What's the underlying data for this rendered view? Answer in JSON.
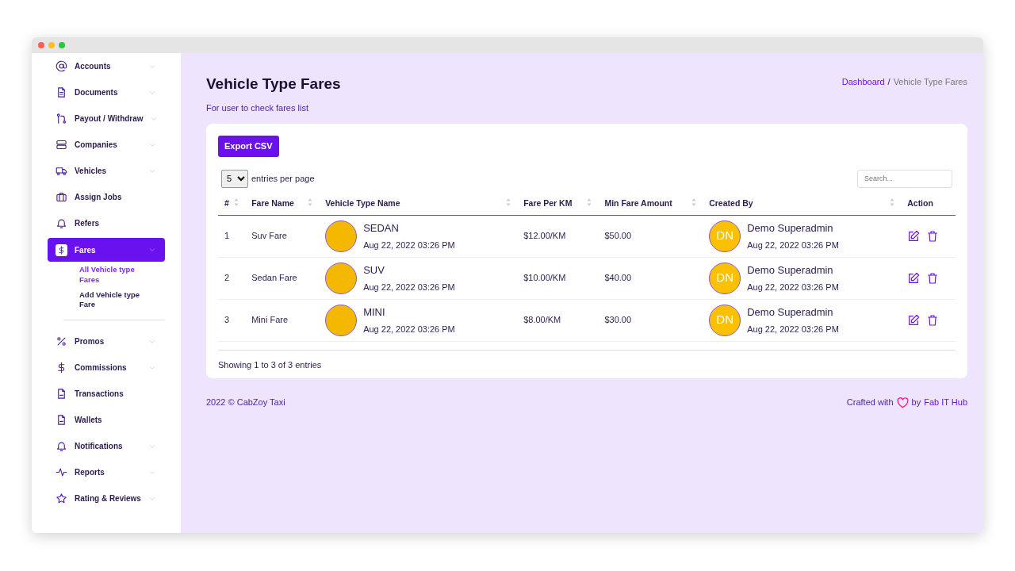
{
  "sidebar": {
    "items": [
      {
        "label": "Accounts",
        "has_submenu": true,
        "selected": false
      },
      {
        "label": "Documents",
        "has_submenu": true,
        "selected": false
      },
      {
        "label": "Payout / Withdraw",
        "has_submenu": true,
        "selected": false
      },
      {
        "label": "Companies",
        "has_submenu": true,
        "selected": false
      },
      {
        "label": "Vehicles",
        "has_submenu": true,
        "selected": false
      },
      {
        "label": "Assign Jobs",
        "has_submenu": false,
        "selected": false
      },
      {
        "label": "Refers",
        "has_submenu": false,
        "selected": false
      },
      {
        "label": "Fares",
        "has_submenu": true,
        "selected": true,
        "children": [
          {
            "label": "All Vehicle type Fares",
            "selected": true
          },
          {
            "label": "Add Vehicle type Fare",
            "selected": false
          }
        ]
      },
      {
        "label": "Promos",
        "has_submenu": true,
        "selected": false
      },
      {
        "label": "Commissions",
        "has_submenu": true,
        "selected": false
      },
      {
        "label": "Transactions",
        "has_submenu": false,
        "selected": false
      },
      {
        "label": "Wallets",
        "has_submenu": false,
        "selected": false
      },
      {
        "label": "Notifications",
        "has_submenu": true,
        "selected": false
      },
      {
        "label": "Reports",
        "has_submenu": true,
        "selected": false
      },
      {
        "label": "Rating & Reviews",
        "has_submenu": true,
        "selected": false
      }
    ]
  },
  "page": {
    "title": "Vehicle Type Fares",
    "subtitle": "For user to check fares list",
    "breadcrumb": [
      "Dashboard",
      "Vehicle Type Fares"
    ],
    "breadcrumb_separator": "/"
  },
  "toolbar": {
    "export_button": "Export CSV",
    "page_size": "5",
    "page_size_label": "entries per page",
    "search": {
      "placeholder": "Search..."
    }
  },
  "table": {
    "columns": [
      {
        "label": "#",
        "sortable": true
      },
      {
        "label": "Fare Name",
        "sortable": true
      },
      {
        "label": "Vehicle Type Name",
        "sortable": true
      },
      {
        "label": "Fare Per KM",
        "sortable": true
      },
      {
        "label": "Min Fare Amount",
        "sortable": true
      },
      {
        "label": "Created By",
        "sortable": true
      },
      {
        "label": "Action",
        "sortable": false
      }
    ],
    "rows": [
      {
        "number": "1",
        "fare_name": "Suv Fare",
        "vehicle_type": "SEDAN",
        "vehicle_date": "Aug 22, 2022 03:26 PM",
        "fare_per_km": "$12.00/KM",
        "min_fare": "$50.00",
        "creator_initials": "DN",
        "creator_name": "Demo Superadmin",
        "created_date": "Aug 22, 2022 03:26 PM"
      },
      {
        "number": "2",
        "fare_name": "Sedan Fare",
        "vehicle_type": "SUV",
        "vehicle_date": "Aug 22, 2022 03:26 PM",
        "fare_per_km": "$10.00/KM",
        "min_fare": "$40.00",
        "creator_initials": "DN",
        "creator_name": "Demo Superadmin",
        "created_date": "Aug 22, 2022 03:26 PM"
      },
      {
        "number": "3",
        "fare_name": "Mini Fare",
        "vehicle_type": "MINI",
        "vehicle_date": "Aug 22, 2022 03:26 PM",
        "fare_per_km": "$8.00/KM",
        "min_fare": "$30.00",
        "creator_initials": "DN",
        "creator_name": "Demo Superadmin",
        "created_date": "Aug 22, 2022 03:26 PM"
      }
    ],
    "info": "Showing 1 to 3 of 3 entries"
  },
  "footer": {
    "copyright": "2022 © CabZoy Taxi",
    "crafted_prefix": "Crafted with",
    "crafted_by": "by",
    "author_link": "Fab IT Hub"
  }
}
